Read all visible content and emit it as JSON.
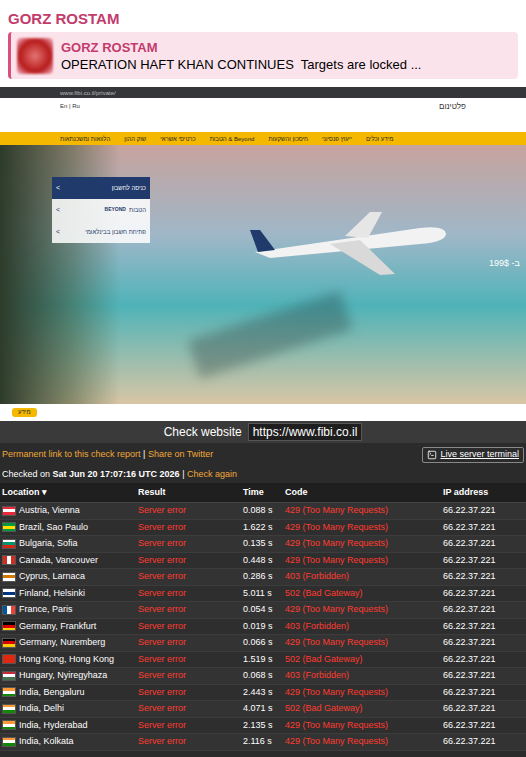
{
  "post": {
    "author": "GORZ ROSTAM",
    "reply": {
      "author": "GORZ ROSTAM",
      "text": "OPERATION HAFT KHAN CONTINUES  Targets are locked ..."
    }
  },
  "website": {
    "url": "www.fibi.co.il/private/",
    "languages": "En | Ru",
    "brand": "פלטינום",
    "nav": [
      "הלוואות ומשכנתאות",
      "שוק ההון",
      "כרטיסי אשראי",
      "Beyond & הטבות",
      "חיסכון והשקעות",
      "ייעוץ פנסיוני",
      "מידע וכלים"
    ],
    "side_menu": [
      {
        "label": "כניסה לחשבון",
        "badge": "",
        "arrow": "<",
        "selected": true
      },
      {
        "label": "הטבות",
        "badge": "BEYOND",
        "arrow": "<",
        "selected": false
      },
      {
        "label": "פתיחת חשבון בבינלאומי",
        "badge": "",
        "arrow": "<",
        "selected": false
      }
    ],
    "price": "199$ -ב",
    "button": "מידע"
  },
  "check": {
    "label": "Check website",
    "url": "https://www.fibi.co.il",
    "permalink": "Permanent link to this check report",
    "separator": "|",
    "share": "Share on Twitter",
    "terminal": "Live server terminal",
    "checked_prefix": "Checked on",
    "checked_at": "Sat Jun 20 17:07:16 UTC 2026",
    "check_again": "Check again",
    "columns": [
      "Location",
      "Result",
      "Time",
      "Code",
      "IP address"
    ],
    "sort_icon": "▾",
    "rows": [
      {
        "location": "Austria, Vienna",
        "result": "Server error",
        "time": "0.088 s",
        "code": "429 (Too Many Requests)",
        "ip": "66.22.37.221",
        "kind": "horizontal",
        "flag": [
          "#ed2939",
          "#ffffff",
          "#ed2939"
        ]
      },
      {
        "location": "Brazil, Sao Paulo",
        "result": "Server error",
        "time": "1.622 s",
        "code": "429 (Too Many Requests)",
        "ip": "66.22.37.221",
        "kind": "horizontal",
        "flag": [
          "#009c3b",
          "#ffdf00",
          "#009c3b"
        ]
      },
      {
        "location": "Bulgaria, Sofia",
        "result": "Server error",
        "time": "0.135 s",
        "code": "429 (Too Many Requests)",
        "ip": "66.22.37.221",
        "kind": "horizontal",
        "flag": [
          "#ffffff",
          "#00966e",
          "#d62612"
        ]
      },
      {
        "location": "Canada, Vancouver",
        "result": "Server error",
        "time": "0.448 s",
        "code": "429 (Too Many Requests)",
        "ip": "66.22.37.221",
        "kind": "vertical",
        "flag": [
          "#d52b1e",
          "#ffffff",
          "#d52b1e"
        ]
      },
      {
        "location": "Cyprus, Larnaca",
        "result": "Server error",
        "time": "0.286 s",
        "code": "403 (Forbidden)",
        "ip": "66.22.37.221",
        "kind": "horizontal",
        "flag": [
          "#ffffff",
          "#d57800",
          "#ffffff"
        ]
      },
      {
        "location": "Finland, Helsinki",
        "result": "Server error",
        "time": "5.011 s",
        "code": "502 (Bad Gateway)",
        "ip": "66.22.37.221",
        "kind": "horizontal",
        "flag": [
          "#ffffff",
          "#003580",
          "#ffffff"
        ]
      },
      {
        "location": "France, Paris",
        "result": "Server error",
        "time": "0.054 s",
        "code": "429 (Too Many Requests)",
        "ip": "66.22.37.221",
        "kind": "vertical",
        "flag": [
          "#0055a4",
          "#ffffff",
          "#ef4135"
        ]
      },
      {
        "location": "Germany, Frankfurt",
        "result": "Server error",
        "time": "0.019 s",
        "code": "403 (Forbidden)",
        "ip": "66.22.37.221",
        "kind": "horizontal",
        "flag": [
          "#000000",
          "#dd0000",
          "#ffce00"
        ]
      },
      {
        "location": "Germany, Nuremberg",
        "result": "Server error",
        "time": "0.066 s",
        "code": "429 (Too Many Requests)",
        "ip": "66.22.37.221",
        "kind": "horizontal",
        "flag": [
          "#000000",
          "#dd0000",
          "#ffce00"
        ]
      },
      {
        "location": "Hong Kong, Hong Kong",
        "result": "Server error",
        "time": "1.519 s",
        "code": "502 (Bad Gateway)",
        "ip": "66.22.37.221",
        "kind": "horizontal",
        "flag": [
          "#de2910",
          "#de2910",
          "#de2910"
        ]
      },
      {
        "location": "Hungary, Nyiregyhaza",
        "result": "Server error",
        "time": "0.068 s",
        "code": "403 (Forbidden)",
        "ip": "66.22.37.221",
        "kind": "horizontal",
        "flag": [
          "#ce2939",
          "#ffffff",
          "#477050"
        ]
      },
      {
        "location": "India, Bengaluru",
        "result": "Server error",
        "time": "2.443 s",
        "code": "429 (Too Many Requests)",
        "ip": "66.22.37.221",
        "kind": "horizontal",
        "flag": [
          "#ff9933",
          "#ffffff",
          "#138808"
        ]
      },
      {
        "location": "India, Delhi",
        "result": "Server error",
        "time": "4.071 s",
        "code": "502 (Bad Gateway)",
        "ip": "66.22.37.221",
        "kind": "horizontal",
        "flag": [
          "#ff9933",
          "#ffffff",
          "#138808"
        ]
      },
      {
        "location": "India, Hyderabad",
        "result": "Server error",
        "time": "2.135 s",
        "code": "429 (Too Many Requests)",
        "ip": "66.22.37.221",
        "kind": "horizontal",
        "flag": [
          "#ff9933",
          "#ffffff",
          "#138808"
        ]
      },
      {
        "location": "India, Kolkata",
        "result": "Server error",
        "time": "2.116 s",
        "code": "429 (Too Many Requests)",
        "ip": "66.22.37.221",
        "kind": "horizontal",
        "flag": [
          "#ff9933",
          "#ffffff",
          "#138808"
        ]
      }
    ]
  }
}
